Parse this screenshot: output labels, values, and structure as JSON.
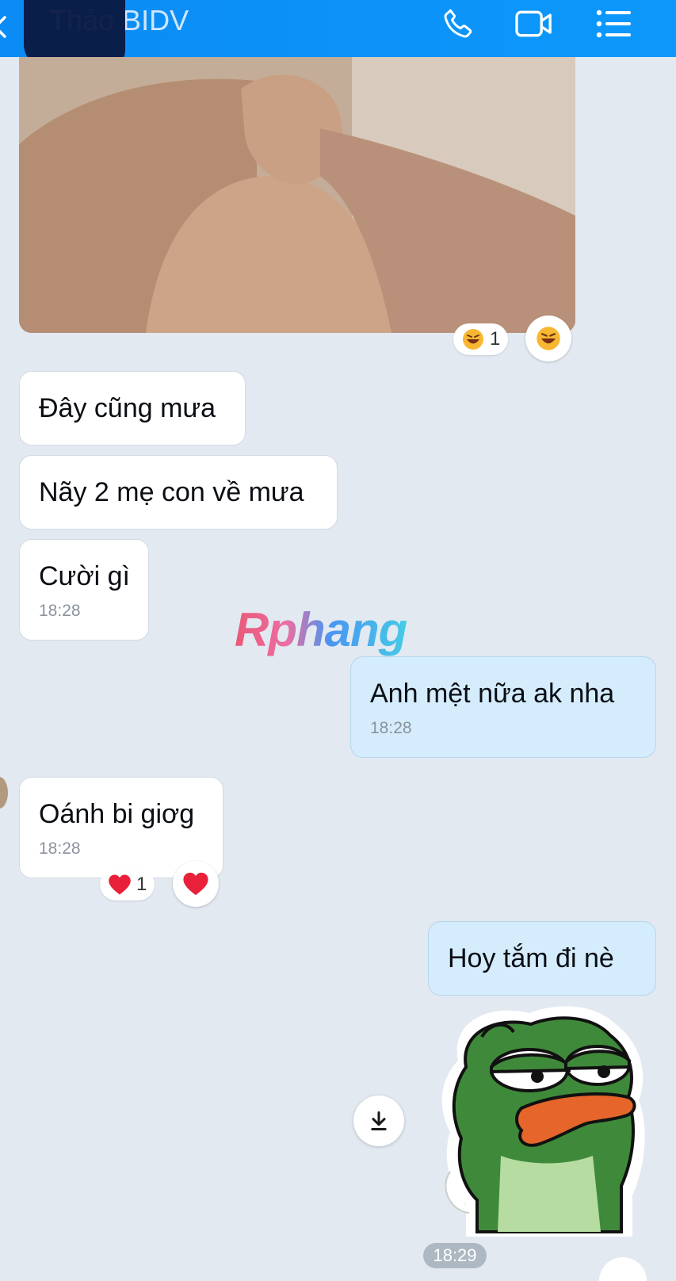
{
  "header": {
    "title": "Thảo BIDV"
  },
  "messages": {
    "photo_reaction_count": "1",
    "m1": {
      "text": "Đây cũng mưa"
    },
    "m2": {
      "text": "Nãy 2 mẹ con về mưa"
    },
    "m3": {
      "text": "Cười gì",
      "time": "18:28"
    },
    "m4": {
      "text": "Anh mệt nữa ak nha",
      "time": "18:28"
    },
    "m5": {
      "text": "Oánh bi giơg",
      "time": "18:28",
      "reaction_count": "1"
    },
    "m6": {
      "text": "Hoy tắm đi nè"
    }
  },
  "sticker_time": "18:29",
  "watermark": "Rphang",
  "icons": {
    "back": "back-icon",
    "call": "phone-icon",
    "video": "video-call-icon",
    "menu": "list-menu-icon",
    "laugh": "laugh-emoji-icon",
    "heart": "heart-icon",
    "download": "download-icon"
  },
  "colors": {
    "header": "#0d98fb",
    "incoming_bubble": "#ffffff",
    "outgoing_bubble": "#d4ecfb",
    "background": "#e2e9f1"
  }
}
